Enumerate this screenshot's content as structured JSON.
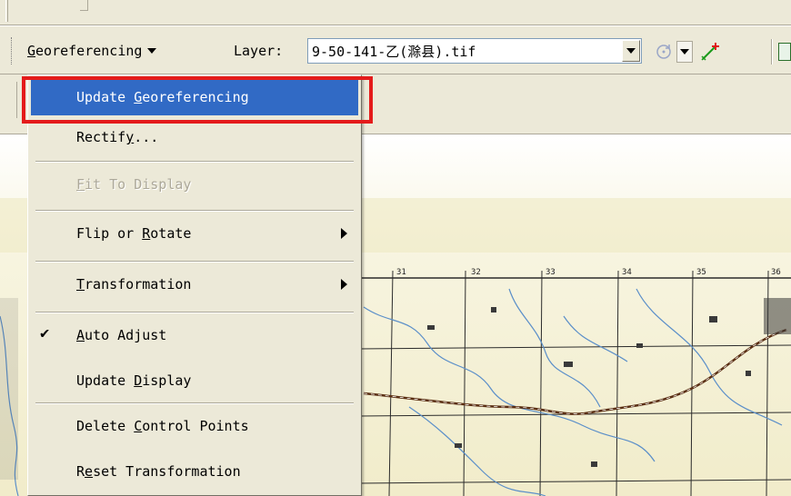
{
  "toolbar": {
    "georeferencing_label": "Georeferencing",
    "layer_label": "Layer:",
    "layer_value": "9-50-141-乙(滁县).tif"
  },
  "menu": {
    "items": [
      {
        "label": "Update Georeferencing",
        "state": "selected"
      },
      {
        "label": "Rectify...",
        "state": "enabled"
      },
      {
        "label": "Fit To Display",
        "state": "disabled"
      },
      {
        "label": "Flip or Rotate",
        "state": "enabled",
        "submenu": true
      },
      {
        "label": "Transformation",
        "state": "enabled",
        "submenu": true
      },
      {
        "label": "Auto Adjust",
        "state": "enabled",
        "checked": true
      },
      {
        "label": "Update Display",
        "state": "enabled"
      },
      {
        "label": "Delete Control Points",
        "state": "enabled"
      },
      {
        "label": "Reset Transformation",
        "state": "enabled"
      }
    ],
    "check_glyph": "✔"
  },
  "map": {
    "grid_labels": [
      "31",
      "32",
      "33",
      "34",
      "35",
      "36"
    ]
  },
  "colors": {
    "menu_selection": "#316ac5",
    "annotation_box": "#e41b1b",
    "map_paper": "#f3efd2",
    "map_grid": "#2b2b2b",
    "map_river": "#5b8fc9",
    "map_road": "#5a2e12"
  }
}
